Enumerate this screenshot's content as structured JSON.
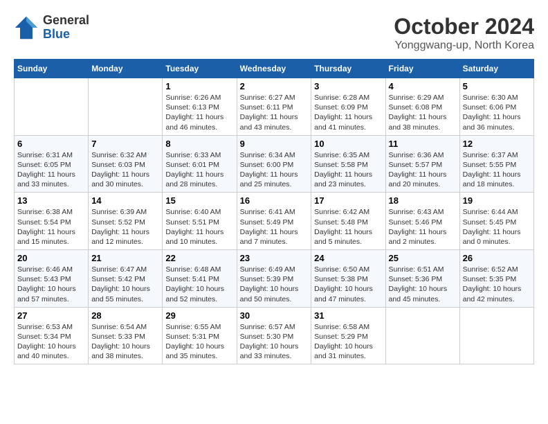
{
  "header": {
    "logo_line1": "General",
    "logo_line2": "Blue",
    "month": "October 2024",
    "location": "Yonggwang-up, North Korea"
  },
  "weekdays": [
    "Sunday",
    "Monday",
    "Tuesday",
    "Wednesday",
    "Thursday",
    "Friday",
    "Saturday"
  ],
  "weeks": [
    [
      {
        "day": null,
        "info": null
      },
      {
        "day": null,
        "info": null
      },
      {
        "day": "1",
        "info": "Sunrise: 6:26 AM\nSunset: 6:13 PM\nDaylight: 11 hours and 46 minutes."
      },
      {
        "day": "2",
        "info": "Sunrise: 6:27 AM\nSunset: 6:11 PM\nDaylight: 11 hours and 43 minutes."
      },
      {
        "day": "3",
        "info": "Sunrise: 6:28 AM\nSunset: 6:09 PM\nDaylight: 11 hours and 41 minutes."
      },
      {
        "day": "4",
        "info": "Sunrise: 6:29 AM\nSunset: 6:08 PM\nDaylight: 11 hours and 38 minutes."
      },
      {
        "day": "5",
        "info": "Sunrise: 6:30 AM\nSunset: 6:06 PM\nDaylight: 11 hours and 36 minutes."
      }
    ],
    [
      {
        "day": "6",
        "info": "Sunrise: 6:31 AM\nSunset: 6:05 PM\nDaylight: 11 hours and 33 minutes."
      },
      {
        "day": "7",
        "info": "Sunrise: 6:32 AM\nSunset: 6:03 PM\nDaylight: 11 hours and 30 minutes."
      },
      {
        "day": "8",
        "info": "Sunrise: 6:33 AM\nSunset: 6:01 PM\nDaylight: 11 hours and 28 minutes."
      },
      {
        "day": "9",
        "info": "Sunrise: 6:34 AM\nSunset: 6:00 PM\nDaylight: 11 hours and 25 minutes."
      },
      {
        "day": "10",
        "info": "Sunrise: 6:35 AM\nSunset: 5:58 PM\nDaylight: 11 hours and 23 minutes."
      },
      {
        "day": "11",
        "info": "Sunrise: 6:36 AM\nSunset: 5:57 PM\nDaylight: 11 hours and 20 minutes."
      },
      {
        "day": "12",
        "info": "Sunrise: 6:37 AM\nSunset: 5:55 PM\nDaylight: 11 hours and 18 minutes."
      }
    ],
    [
      {
        "day": "13",
        "info": "Sunrise: 6:38 AM\nSunset: 5:54 PM\nDaylight: 11 hours and 15 minutes."
      },
      {
        "day": "14",
        "info": "Sunrise: 6:39 AM\nSunset: 5:52 PM\nDaylight: 11 hours and 12 minutes."
      },
      {
        "day": "15",
        "info": "Sunrise: 6:40 AM\nSunset: 5:51 PM\nDaylight: 11 hours and 10 minutes."
      },
      {
        "day": "16",
        "info": "Sunrise: 6:41 AM\nSunset: 5:49 PM\nDaylight: 11 hours and 7 minutes."
      },
      {
        "day": "17",
        "info": "Sunrise: 6:42 AM\nSunset: 5:48 PM\nDaylight: 11 hours and 5 minutes."
      },
      {
        "day": "18",
        "info": "Sunrise: 6:43 AM\nSunset: 5:46 PM\nDaylight: 11 hours and 2 minutes."
      },
      {
        "day": "19",
        "info": "Sunrise: 6:44 AM\nSunset: 5:45 PM\nDaylight: 11 hours and 0 minutes."
      }
    ],
    [
      {
        "day": "20",
        "info": "Sunrise: 6:46 AM\nSunset: 5:43 PM\nDaylight: 10 hours and 57 minutes."
      },
      {
        "day": "21",
        "info": "Sunrise: 6:47 AM\nSunset: 5:42 PM\nDaylight: 10 hours and 55 minutes."
      },
      {
        "day": "22",
        "info": "Sunrise: 6:48 AM\nSunset: 5:41 PM\nDaylight: 10 hours and 52 minutes."
      },
      {
        "day": "23",
        "info": "Sunrise: 6:49 AM\nSunset: 5:39 PM\nDaylight: 10 hours and 50 minutes."
      },
      {
        "day": "24",
        "info": "Sunrise: 6:50 AM\nSunset: 5:38 PM\nDaylight: 10 hours and 47 minutes."
      },
      {
        "day": "25",
        "info": "Sunrise: 6:51 AM\nSunset: 5:36 PM\nDaylight: 10 hours and 45 minutes."
      },
      {
        "day": "26",
        "info": "Sunrise: 6:52 AM\nSunset: 5:35 PM\nDaylight: 10 hours and 42 minutes."
      }
    ],
    [
      {
        "day": "27",
        "info": "Sunrise: 6:53 AM\nSunset: 5:34 PM\nDaylight: 10 hours and 40 minutes."
      },
      {
        "day": "28",
        "info": "Sunrise: 6:54 AM\nSunset: 5:33 PM\nDaylight: 10 hours and 38 minutes."
      },
      {
        "day": "29",
        "info": "Sunrise: 6:55 AM\nSunset: 5:31 PM\nDaylight: 10 hours and 35 minutes."
      },
      {
        "day": "30",
        "info": "Sunrise: 6:57 AM\nSunset: 5:30 PM\nDaylight: 10 hours and 33 minutes."
      },
      {
        "day": "31",
        "info": "Sunrise: 6:58 AM\nSunset: 5:29 PM\nDaylight: 10 hours and 31 minutes."
      },
      {
        "day": null,
        "info": null
      },
      {
        "day": null,
        "info": null
      }
    ]
  ]
}
